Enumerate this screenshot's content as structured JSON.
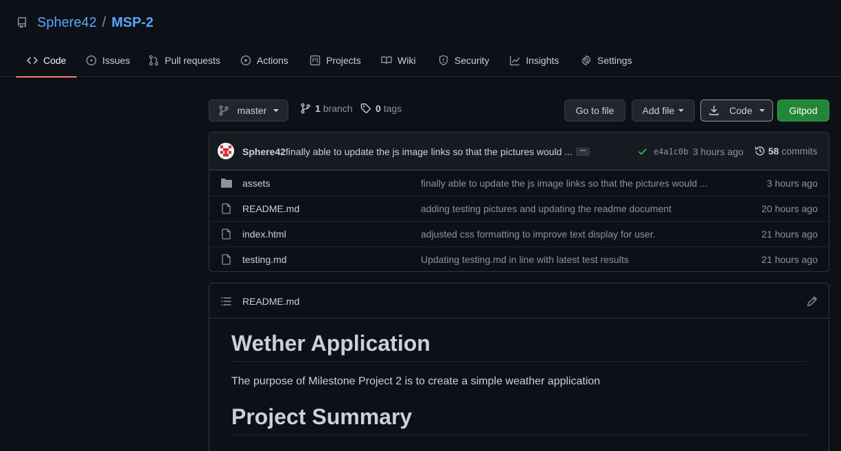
{
  "repo": {
    "owner": "Sphere42",
    "separator": "/",
    "name": "MSP-2"
  },
  "tabs": [
    {
      "label": "Code",
      "icon": "code-icon",
      "active": true
    },
    {
      "label": "Issues",
      "icon": "issue-icon"
    },
    {
      "label": "Pull requests",
      "icon": "pull-request-icon"
    },
    {
      "label": "Actions",
      "icon": "play-icon"
    },
    {
      "label": "Projects",
      "icon": "project-icon"
    },
    {
      "label": "Wiki",
      "icon": "book-icon"
    },
    {
      "label": "Security",
      "icon": "shield-icon"
    },
    {
      "label": "Insights",
      "icon": "graph-icon"
    },
    {
      "label": "Settings",
      "icon": "gear-icon"
    }
  ],
  "toolbar": {
    "branch_label": "master",
    "branch_count": "1",
    "branch_text": "branch",
    "tags_count": "0",
    "tags_text": "tags",
    "go_to_file": "Go to file",
    "add_file": "Add file",
    "code": "Code",
    "gitpod": "Gitpod"
  },
  "latest_commit": {
    "author": "Sphere42",
    "message": "finally able to update the js image links so that the pictures would ...",
    "ellipsis": "...",
    "sha": "e4a1c0b",
    "time": "3 hours ago",
    "commit_count": "58",
    "commit_text": "commits"
  },
  "files": [
    {
      "type": "dir",
      "name": "assets",
      "message": "finally able to update the js image links so that the pictures would ...",
      "time": "3 hours ago"
    },
    {
      "type": "file",
      "name": "README.md",
      "message": "adding testing pictures and updating the readme document",
      "time": "20 hours ago"
    },
    {
      "type": "file",
      "name": "index.html",
      "message": "adjusted css formatting to improve text display for user.",
      "time": "21 hours ago"
    },
    {
      "type": "file",
      "name": "testing.md",
      "message": "Updating testing.md in line with latest test results",
      "time": "21 hours ago"
    }
  ],
  "readme": {
    "title": "README.md",
    "h1": "Wether Application",
    "p1": "The purpose of Milestone Project 2 is to create a simple weather application",
    "h2": "Project Summary"
  },
  "colors": {
    "background": "#0d1117",
    "link": "#58a6ff",
    "active_tab_underline": "#f78166",
    "primary_button": "#238636",
    "success_check": "#3fb950"
  }
}
